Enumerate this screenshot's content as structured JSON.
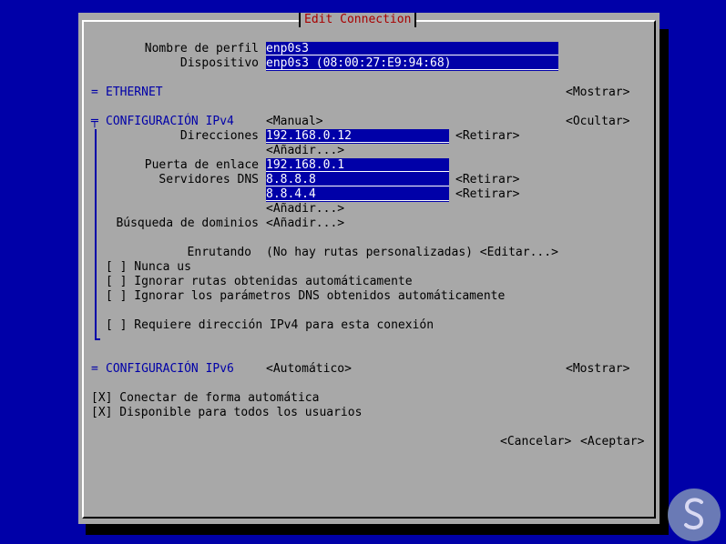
{
  "dialog": {
    "title": "Edit Connection"
  },
  "profile": {
    "name_label": "Nombre de perfil",
    "name_value": "enp0s3",
    "device_label": "Dispositivo",
    "device_value": "enp0s3 (08:00:27:E9:94:68)"
  },
  "ethernet": {
    "marker": "=",
    "label": "ETHERNET",
    "toggle": "<Mostrar>"
  },
  "ipv4": {
    "marker": "╤",
    "label": "CONFIGURACIÓN IPv4",
    "mode": "<Manual>",
    "toggle": "<Ocultar>",
    "addresses_label": "Direcciones",
    "address_1": "192.168.0.12",
    "remove": "<Retirar>",
    "add": "<Añadir...>",
    "gateway_label": "Puerta de enlace",
    "gateway_value": "192.168.0.1",
    "dns_label": "Servidores DNS",
    "dns_1": "8.8.8.8",
    "dns_2": "8.8.4.4",
    "search_label": "Búsqueda de dominios",
    "routing_label": "Enrutando",
    "routing_value": "(No hay rutas personalizadas) <Editar...>",
    "never_default": "[ ] Nunca us",
    "ignore_routes": "[ ] Ignorar rutas obtenidas automáticamente",
    "ignore_dns": "[ ] Ignorar los parámetros DNS obtenidos automáticamente",
    "require_ipv4": "[ ] Requiere dirección IPv4 para esta conexión"
  },
  "ipv6": {
    "marker": "=",
    "label": "CONFIGURACIÓN IPv6",
    "mode": "<Automático>",
    "toggle": "<Mostrar>"
  },
  "options": {
    "autoconnect": "[X] Conectar de forma automática",
    "all_users": "[X] Disponible para todos los usuarios"
  },
  "actions": {
    "cancel": "<Cancelar>",
    "accept": "<Aceptar>"
  },
  "colors": {
    "background": "#0000a8",
    "dialog": "#a8a8a8",
    "title": "#a80000",
    "field": "#0000a8"
  }
}
